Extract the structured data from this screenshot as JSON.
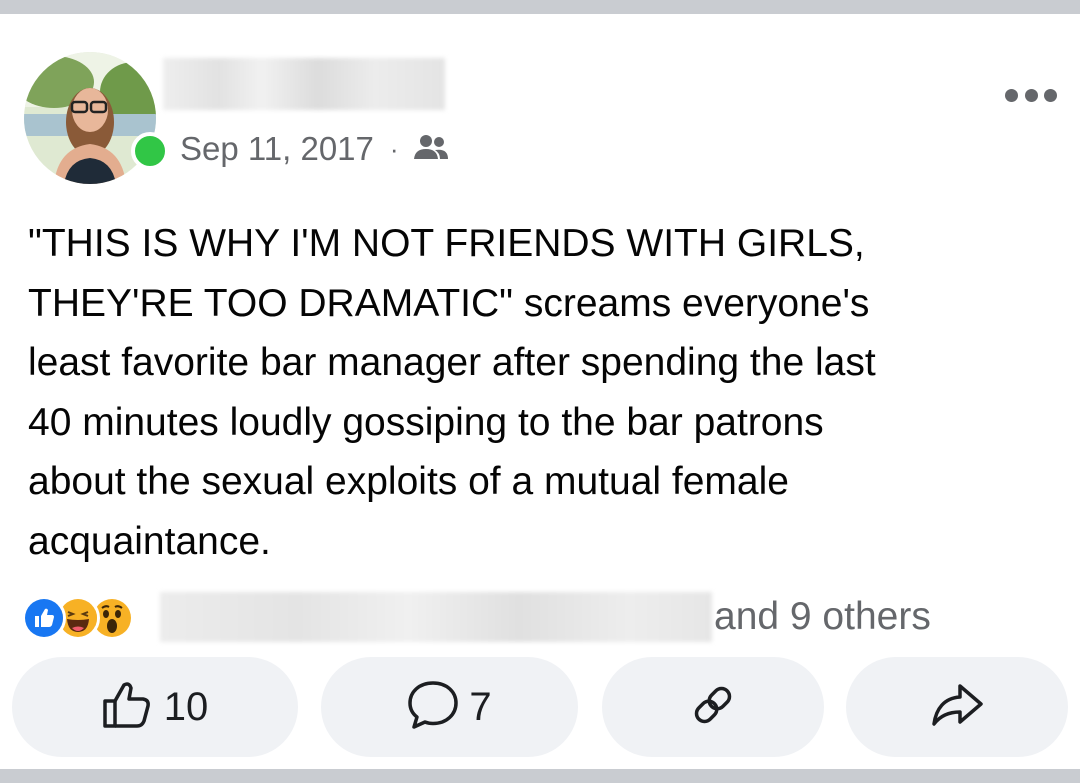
{
  "post": {
    "date": "Sep 11, 2017",
    "separator": "·",
    "audience_icon": "friends-icon",
    "text": "\"THIS IS WHY I'M NOT FRIENDS WITH GIRLS,\nTHEY'RE TOO DRAMATIC\" screams everyone's\nleast favorite bar manager after spending the last\n40 minutes loudly gossiping to the bar patrons\nabout the sexual exploits of a mutual female\nacquaintance."
  },
  "reactions": {
    "icons": [
      "like-icon",
      "haha-icon",
      "wow-icon"
    ],
    "others_text": "and 9 others"
  },
  "actions": {
    "like_count": "10",
    "comment_count": "7",
    "icons": [
      "thumbs-up-icon",
      "comment-icon",
      "link-icon",
      "share-icon"
    ]
  },
  "colors": {
    "online_status": "#31c646",
    "like_blue": "#1877f2",
    "meta_gray": "#65676b",
    "button_bg": "#f0f2f5"
  }
}
